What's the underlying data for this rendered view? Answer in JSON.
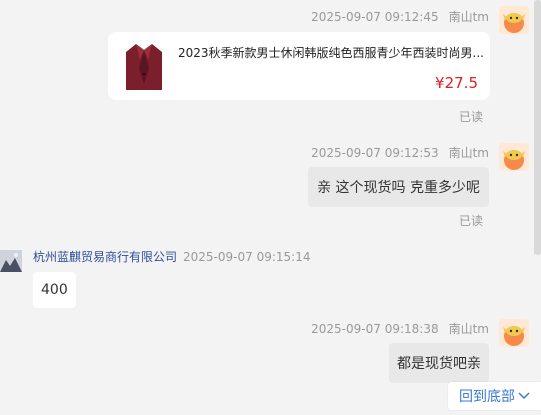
{
  "messages": [
    {
      "time": "2025-09-07 09:12:45",
      "sender": "南山tm",
      "product_title": "2023秋季新款男士休闲韩版纯色西服青少年西装时尚男...",
      "price": "¥27.5",
      "status": "已读"
    },
    {
      "time": "2025-09-07 09:12:53",
      "sender": "南山tm",
      "text": "亲 这个现货吗 克重多少呢",
      "status": "已读"
    },
    {
      "time": "2025-09-07 09:15:14",
      "sender": "杭州蓝麒贸易商行有限公司",
      "text": "400"
    },
    {
      "time": "2025-09-07 09:18:38",
      "sender": "南山tm",
      "text": "都是现货吧亲"
    }
  ],
  "back_to_bottom": "回到底部",
  "colors": {
    "background": "#f3f3f3",
    "link": "#3a7bd5",
    "price": "#e02020",
    "shop_name": "#2b4f9a"
  },
  "icons": {
    "avatar": "cow-avatar-icon",
    "shop_avatar": "shop-avatar-icon",
    "product": "blazer-thumbnail",
    "chevron": "chevron-down-icon"
  }
}
